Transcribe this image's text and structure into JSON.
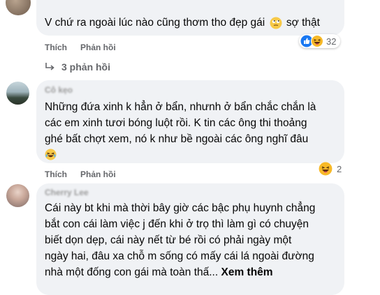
{
  "comments": [
    {
      "text_lines": [
        "V chứ ra ngoài lúc nào cũng thơm tho đẹp gái",
        "sợ thật"
      ],
      "actions": {
        "like": "Thích",
        "reply": "Phản hồi"
      },
      "reaction_count": "32",
      "replies_label": "3 phản hồi"
    },
    {
      "author": "Cô kẹo",
      "text_lines": [
        "Những đứa xinh k hẳn ở bẩn, nhưnh ở bẩn chắc chắn là",
        "các em xinh tươi bóng luột rồi. K tin các ông thi thoảng",
        "ghé bất chợt xem, nó k như bề ngoài các ông nghĩ đâu"
      ],
      "actions": {
        "like": "Thích",
        "reply": "Phản hồi"
      },
      "reaction_count": "2"
    },
    {
      "author": "Cherry Lee",
      "text_lines": [
        "Cái này bt khi mà thời bây giờ các bậc phụ huynh chẳng",
        "bắt con cái làm việc j đến khi ở trọ thì làm gì có chuyện",
        "biết dọn dẹp, cái này nết từ bé rồi có phải ngày một",
        "ngày hai, đâu xa chỗ m sống có mấy cái lá ngoài đường",
        "nhà một đống con gái mà toàn thấ..."
      ],
      "see_more": "Xem thêm"
    }
  ],
  "colors": {
    "bubble": "#f0f2f5",
    "secondary_text": "#65676b",
    "like_blue": "#1877f2",
    "haha_yellow": "#f7b928"
  },
  "icons": [
    "avatar",
    "rolling-eyes-emoji-icon",
    "like-reaction-icon",
    "haha-reaction-icon",
    "reply-arrow-icon",
    "laughing-emoji-icon"
  ]
}
